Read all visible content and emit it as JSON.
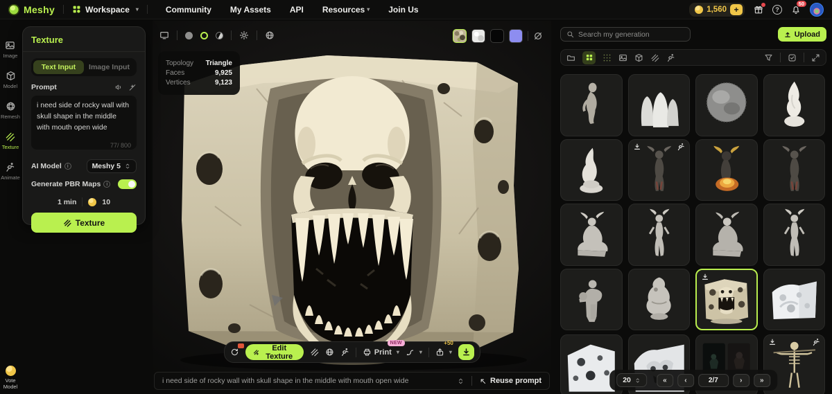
{
  "navbar": {
    "logo_text": "Meshy",
    "workspace_label": "Workspace",
    "links": [
      "Community",
      "My Assets",
      "API",
      "Resources",
      "Join Us"
    ],
    "credits": "1,560",
    "bell_badge": "50"
  },
  "rail": {
    "items": [
      {
        "label": "Image"
      },
      {
        "label": "Model"
      },
      {
        "label": "Remesh"
      },
      {
        "label": "Texture"
      },
      {
        "label": "Animate"
      }
    ],
    "vote_label": "Vote Model"
  },
  "texture_panel": {
    "title": "Texture",
    "tab_text": "Text Input",
    "tab_image": "Image Input",
    "prompt_label": "Prompt",
    "prompt_value": "i need side of rocky wall with skull shape in the middle with mouth open wide",
    "char_counter": "77/ 800",
    "ai_model_label": "AI Model",
    "ai_model_value": "Meshy 5",
    "pbr_label": "Generate PBR Maps",
    "eta": "1 min",
    "cost": "10",
    "generate_label": "Texture"
  },
  "viewport": {
    "stats": {
      "topology_label": "Topology",
      "topology_value": "Triangle",
      "faces_label": "Faces",
      "faces_value": "9,925",
      "vertices_label": "Vertices",
      "vertices_value": "9,123"
    },
    "toolbar": {
      "edit_texture_label": "Edit Texture",
      "print_label": "Print",
      "new_badge": "NEW",
      "share_bonus": "+50"
    },
    "prompt_bar": {
      "text": "i need side of rocky wall with skull shape in the middle with mouth open wide",
      "reuse_label": "Reuse prompt"
    }
  },
  "gallery": {
    "search_placeholder": "Search my generation",
    "upload_label": "Upload",
    "items": [
      {
        "variant": "zombie-figure"
      },
      {
        "variant": "ghost-trio"
      },
      {
        "variant": "stone-sphere"
      },
      {
        "variant": "flame-figure"
      },
      {
        "variant": "flame-statue"
      },
      {
        "variant": "demon-dark",
        "download_icon": true,
        "animate_icon": true
      },
      {
        "variant": "demon-fire"
      },
      {
        "variant": "demon-dark-2"
      },
      {
        "variant": "demon-seated"
      },
      {
        "variant": "demon-standing"
      },
      {
        "variant": "demon-seated-shaded"
      },
      {
        "variant": "demon-standing-2"
      },
      {
        "variant": "villager-figure"
      },
      {
        "variant": "gnome-creature"
      },
      {
        "variant": "skull-rock-wall",
        "selected": true,
        "download_icon": true
      },
      {
        "variant": "white-rock-wall"
      },
      {
        "variant": "rock-wall-3"
      },
      {
        "variant": "rock-wall-4"
      },
      {
        "variant": "dark-render-pair"
      },
      {
        "variant": "skeleton-spear",
        "download_icon": true,
        "animate_icon": true
      }
    ],
    "pagination": {
      "page_size": "20",
      "page": "2/7"
    }
  }
}
